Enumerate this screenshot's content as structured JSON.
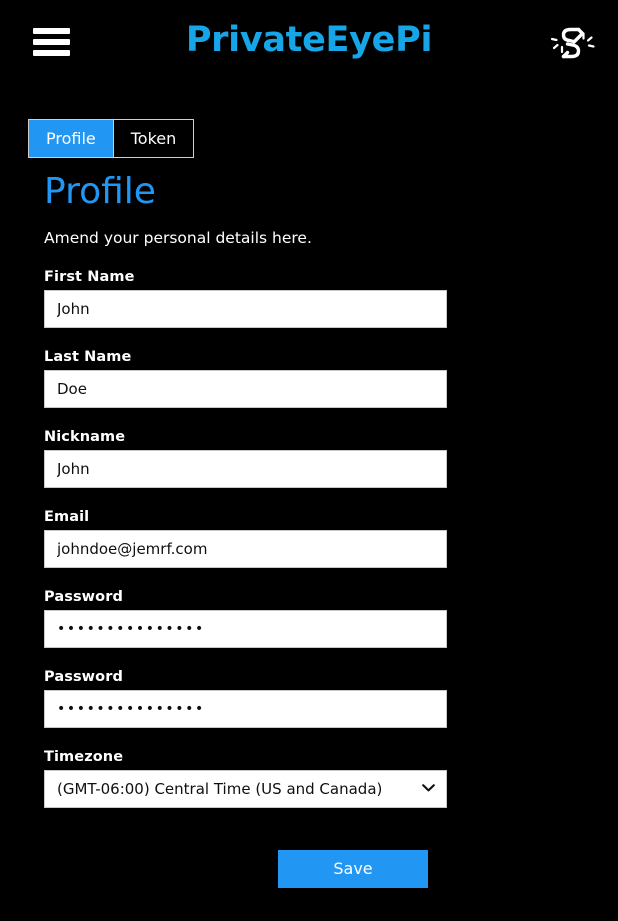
{
  "colors": {
    "accent": "#2196f3",
    "brand": "#16a6e8",
    "background": "#000000",
    "field_background": "#ffffff",
    "text": "#ffffff"
  },
  "header": {
    "menu_icon": "hamburger-menu-icon",
    "brand_title": "PrivateEyePi",
    "status_icon": "broken-link-icon"
  },
  "tabs": [
    {
      "label": "Profile",
      "active": true
    },
    {
      "label": "Token",
      "active": false
    }
  ],
  "main": {
    "title": "Profile",
    "description": "Amend your personal details here.",
    "fields": [
      {
        "label": "First Name",
        "value": "John",
        "type": "text",
        "name": "first-name"
      },
      {
        "label": "Last Name",
        "value": "Doe",
        "type": "text",
        "name": "last-name"
      },
      {
        "label": "Nickname",
        "value": "John",
        "type": "text",
        "name": "nickname"
      },
      {
        "label": "Email",
        "value": "johndoe@jemrf.com",
        "type": "text",
        "name": "email"
      },
      {
        "label": "Password",
        "value": "•••••••••••••••",
        "type": "password",
        "name": "password"
      },
      {
        "label": "Password",
        "value": "•••••••••••••••",
        "type": "password",
        "name": "password-confirm"
      }
    ],
    "timezone": {
      "label": "Timezone",
      "selected": "(GMT-06:00) Central Time (US and Canada)",
      "chevron_icon": "chevron-down-icon"
    },
    "save_label": "Save"
  }
}
